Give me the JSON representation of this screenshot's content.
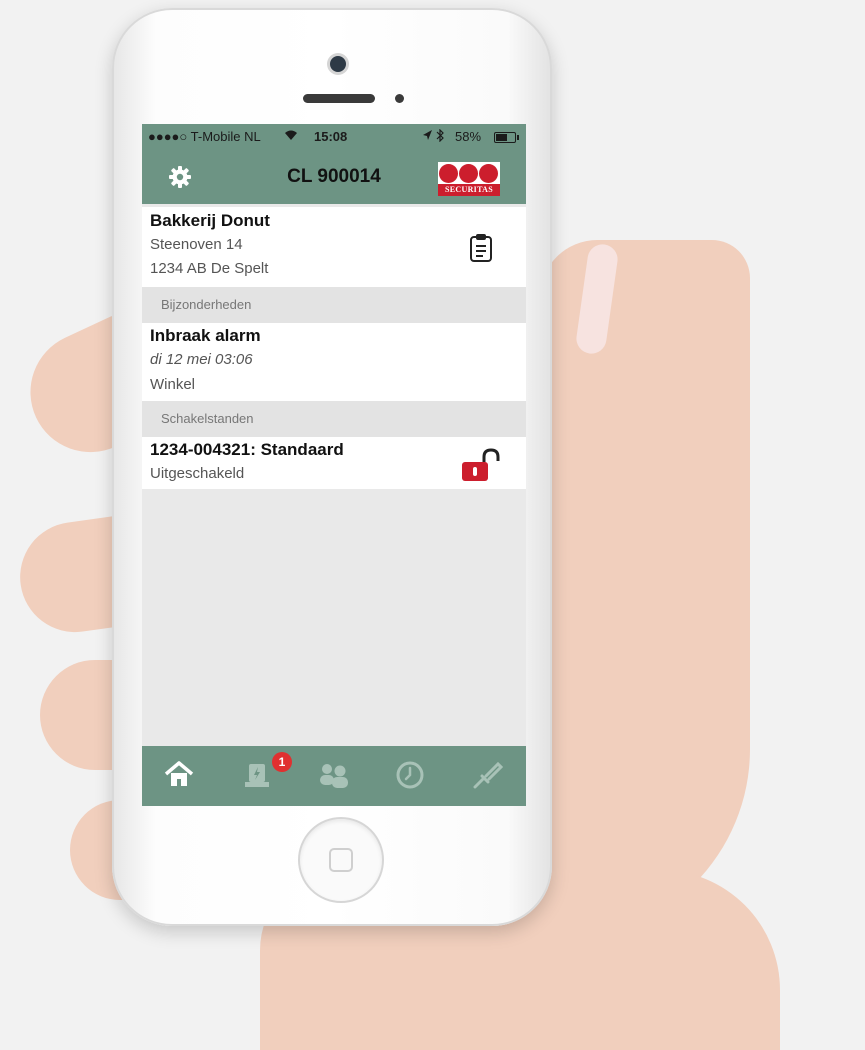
{
  "status_bar": {
    "carrier": "●●●●○ T-Mobile NL",
    "time": "15:08",
    "battery": "58%"
  },
  "header": {
    "title": "CL 900014",
    "logo_text": "SECURITAS"
  },
  "location": {
    "name": "Bakkerij Donut",
    "street": "Steenoven 14",
    "city": "1234 AB  De Spelt"
  },
  "details_section": {
    "label": "Bijzonderheden",
    "alarm_title": "Inbraak alarm",
    "alarm_time": "di 12 mei 03:06",
    "alarm_zone": "Winkel"
  },
  "switch_section": {
    "label": "Schakelstanden",
    "item_title": "1234-004321: Standaard",
    "item_status": "Uitgeschakeld"
  },
  "tabs": [
    {
      "icon": "home-icon",
      "active": true
    },
    {
      "icon": "alarm-icon",
      "badge": "1"
    },
    {
      "icon": "contacts-icon"
    },
    {
      "icon": "history-icon"
    },
    {
      "icon": "tools-icon"
    }
  ],
  "colors": {
    "brand_green": "#6d9484",
    "securitas_red": "#cc1e2d",
    "badge_red": "#e03030"
  }
}
